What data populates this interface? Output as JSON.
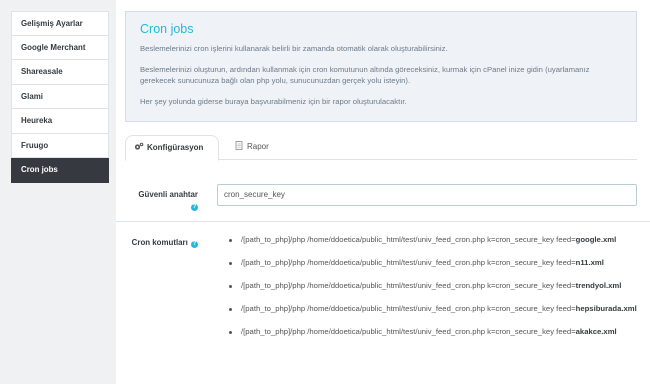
{
  "sidebar": {
    "items": [
      {
        "label": "Gelişmiş Ayarlar"
      },
      {
        "label": "Google Merchant"
      },
      {
        "label": "Shareasale"
      },
      {
        "label": "Glami"
      },
      {
        "label": "Heureka"
      },
      {
        "label": "Fruugo"
      },
      {
        "label": "Cron jobs"
      }
    ]
  },
  "alert": {
    "title": "Cron jobs",
    "p1": "Beslemelerinizi cron işlerini kullanarak belirli bir zamanda otomatik olarak oluşturabilirsiniz.",
    "p2": "Beslemelerinizi oluşturun, ardından kullanmak için cron komutunun altında göreceksiniz, kurmak için cPanel inize gidin (uyarlamanız gerekecek sunucunuza bağlı olan php yolu, sunucunuzdan gerçek yolu isteyin).",
    "p3": "Her şey yolunda giderse buraya başvurabilmeniz için bir rapor oluşturulacaktır."
  },
  "tabs": {
    "config": "Konfigürasyon",
    "report": "Rapor"
  },
  "form": {
    "key_label": "Güvenli anahtar",
    "key_value": "cron_secure_key",
    "commands_label": "Cron komutları"
  },
  "commands": [
    {
      "prefix": "/[path_to_php]/php /home/ddoetica/public_html/test/univ_feed_cron.php k=cron_secure_key feed=",
      "feed": "google.xml"
    },
    {
      "prefix": "/[path_to_php]/php /home/ddoetica/public_html/test/univ_feed_cron.php k=cron_secure_key feed=",
      "feed": "n11.xml"
    },
    {
      "prefix": "/[path_to_php]/php /home/ddoetica/public_html/test/univ_feed_cron.php k=cron_secure_key feed=",
      "feed": "trendyol.xml"
    },
    {
      "prefix": "/[path_to_php]/php /home/ddoetica/public_html/test/univ_feed_cron.php k=cron_secure_key feed=",
      "feed": "hepsiburada.xml"
    },
    {
      "prefix": "/[path_to_php]/php /home/ddoetica/public_html/test/univ_feed_cron.php k=cron_secure_key feed=",
      "feed": "akakce.xml"
    }
  ],
  "colors": {
    "accent": "#25b9d7",
    "active_sidebar": "#363a40"
  }
}
